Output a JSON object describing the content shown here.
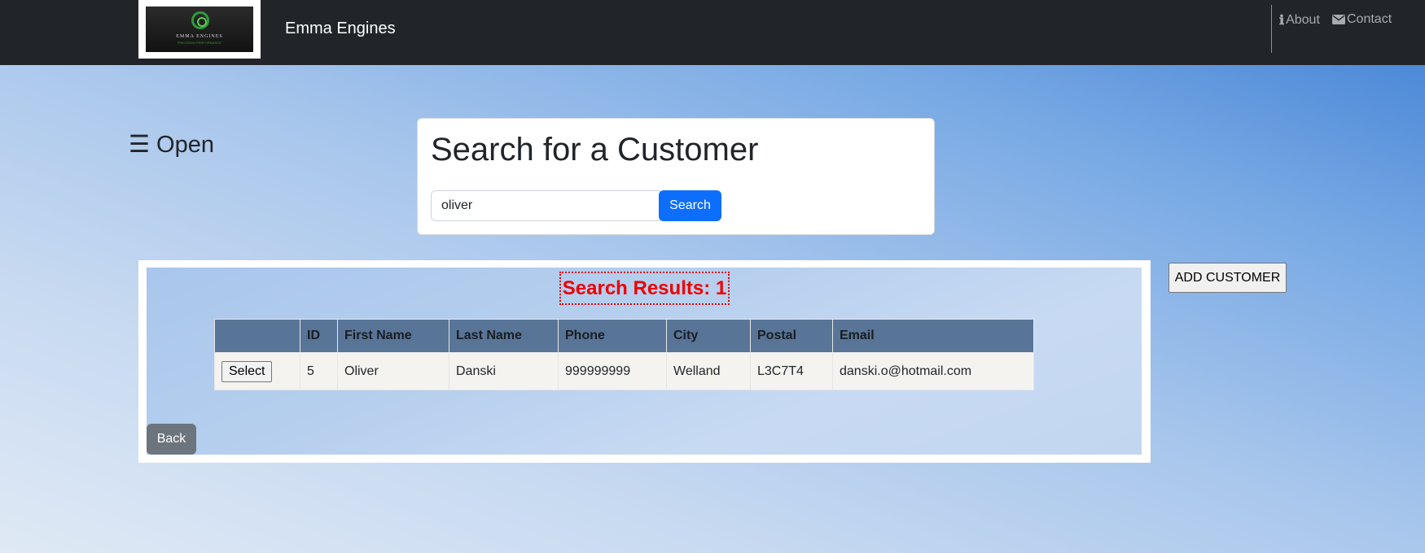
{
  "navbar": {
    "logo_text": "EMMA ENGINES",
    "logo_tagline": "PRECISION PERFORMANCE",
    "brand": "Emma Engines",
    "links": {
      "about": "About",
      "contact": "Contact"
    }
  },
  "sidebar": {
    "toggle_label": "☰ Open"
  },
  "search": {
    "title": "Search for a Customer",
    "query": "oliver",
    "button_label": "Search"
  },
  "results": {
    "heading": "Search Results: 1",
    "columns": [
      "",
      "ID",
      "First Name",
      "Last Name",
      "Phone",
      "City",
      "Postal",
      "Email"
    ],
    "rows": [
      {
        "action_label": "Select",
        "id": "5",
        "first_name": "Oliver",
        "last_name": "Danski",
        "phone": "999999999",
        "city": "Welland",
        "postal": "L3C7T4",
        "email": "danski.o@hotmail.com"
      }
    ],
    "back_label": "Back"
  },
  "actions": {
    "add_customer_label": "ADD CUSTOMER"
  },
  "colors": {
    "navbar_bg": "#212529",
    "primary_button": "#0d6efd",
    "secondary_button": "#6c757d",
    "table_header": "#587597",
    "results_heading": "#ee0000"
  },
  "icons": {
    "about": "info-icon",
    "contact": "envelope-icon",
    "menu": "hamburger-icon"
  }
}
